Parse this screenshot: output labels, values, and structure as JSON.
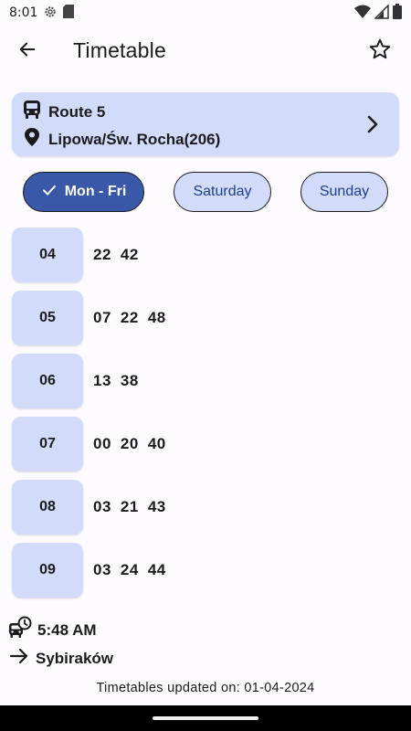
{
  "status_bar": {
    "time": "8:01",
    "icons": [
      "gear-icon",
      "sd-card-icon",
      "wifi-icon",
      "signal-icon",
      "battery-icon"
    ]
  },
  "app_bar": {
    "title": "Timetable",
    "back_icon": "arrow-back-icon",
    "favorite_icon": "star-outline-icon"
  },
  "route_card": {
    "route": "Route 5",
    "stop": "Lipowa/Św. Rocha(206)"
  },
  "day_chips": [
    {
      "label": "Mon - Fri",
      "selected": true
    },
    {
      "label": "Saturday",
      "selected": false
    },
    {
      "label": "Sunday",
      "selected": false
    }
  ],
  "timetable": [
    {
      "hour": "04",
      "minutes": [
        "22",
        "42"
      ]
    },
    {
      "hour": "05",
      "minutes": [
        "07",
        "22",
        "48"
      ]
    },
    {
      "hour": "06",
      "minutes": [
        "13",
        "38"
      ]
    },
    {
      "hour": "07",
      "minutes": [
        "00",
        "20",
        "40"
      ]
    },
    {
      "hour": "08",
      "minutes": [
        "03",
        "21",
        "43"
      ]
    },
    {
      "hour": "09",
      "minutes": [
        "03",
        "24",
        "44"
      ]
    }
  ],
  "next_departure": {
    "time": "5:48 AM",
    "direction": "Sybiraków"
  },
  "footer": {
    "updated": "Timetables updated on: 01-04-2024"
  },
  "colors": {
    "background": "#fdfbff",
    "card": "#d2dcfa",
    "selected_chip": "#3a58a8",
    "chip_text": "#1d3f8c",
    "text": "#1b1b1f"
  }
}
